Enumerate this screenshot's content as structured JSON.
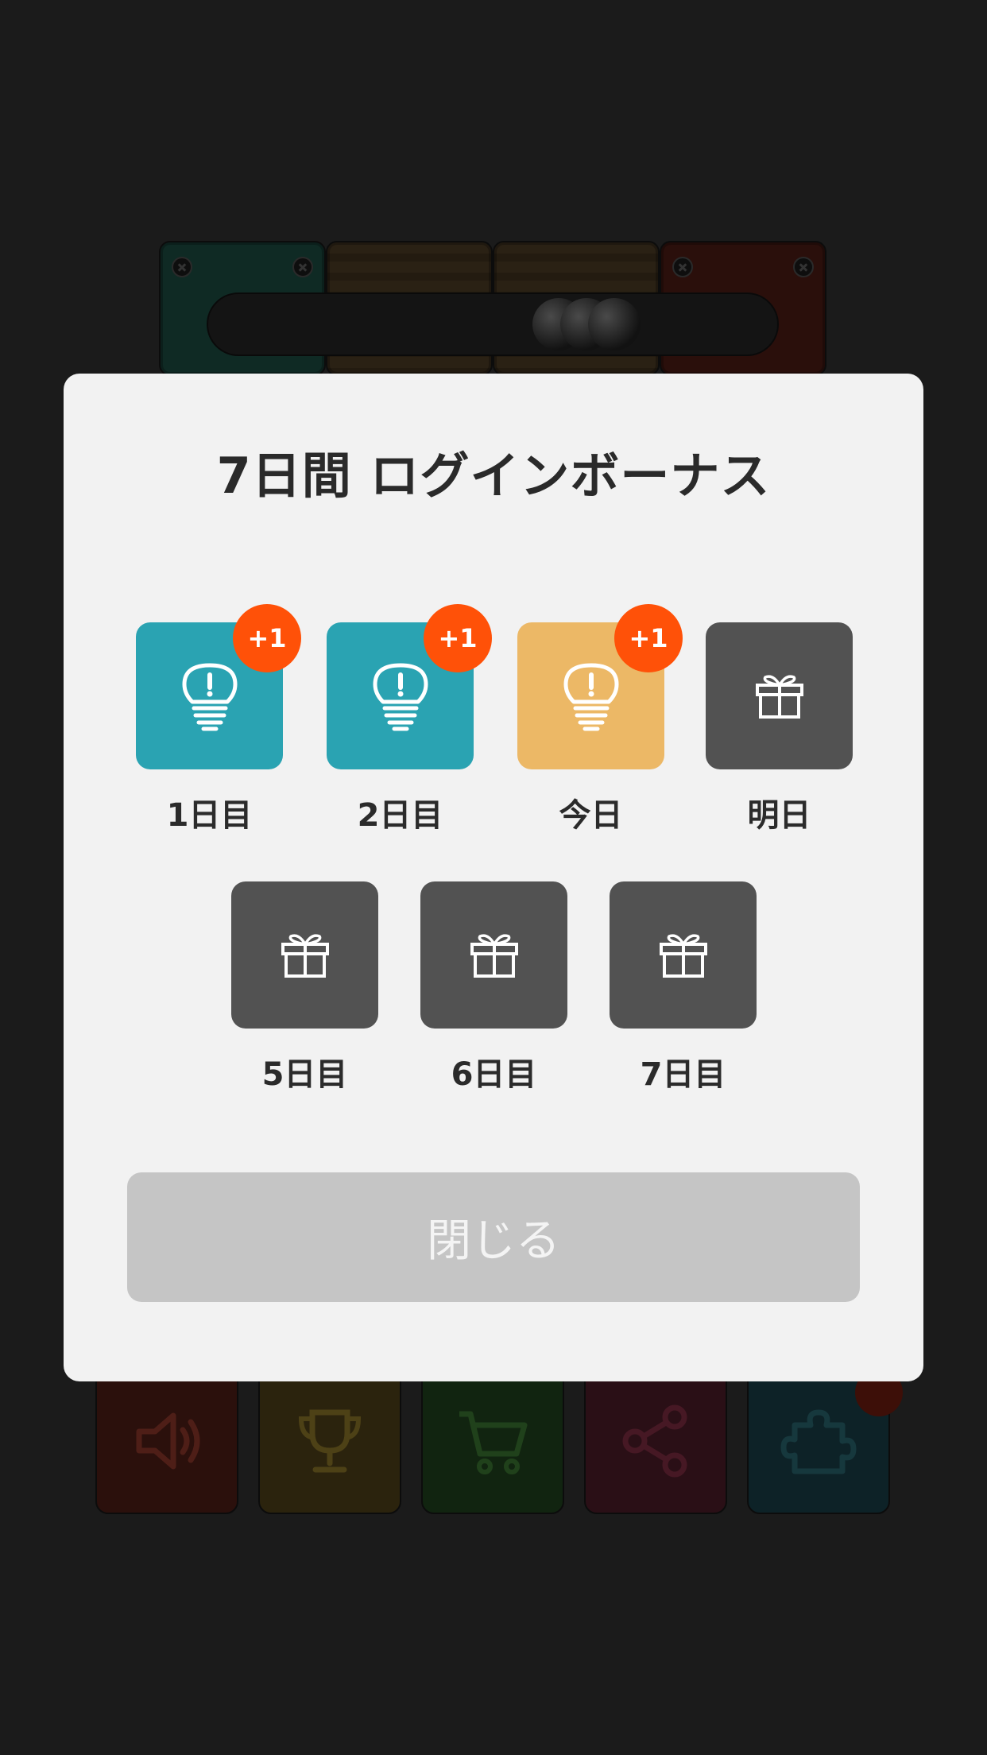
{
  "colors": {
    "claimed": "#2aa3b2",
    "today": "#ecb866",
    "locked": "#525252",
    "badge": "#ff5108",
    "button_bg": "#c5c5c5"
  },
  "modal": {
    "title": "7日間 ログインボーナス",
    "days": [
      {
        "label": "1日目",
        "icon": "lightbulb-icon",
        "state": "claimed",
        "badge": "+1"
      },
      {
        "label": "2日目",
        "icon": "lightbulb-icon",
        "state": "claimed",
        "badge": "+1"
      },
      {
        "label": "今日",
        "icon": "lightbulb-icon",
        "state": "today",
        "badge": "+1"
      },
      {
        "label": "明日",
        "icon": "gift-icon",
        "state": "locked"
      },
      {
        "label": "5日目",
        "icon": "gift-icon",
        "state": "locked"
      },
      {
        "label": "6日目",
        "icon": "gift-icon",
        "state": "locked"
      },
      {
        "label": "7日目",
        "icon": "gift-icon",
        "state": "locked"
      }
    ],
    "close_label": "閉じる"
  },
  "background": {
    "bottom_buttons": [
      {
        "icon": "speaker-icon"
      },
      {
        "icon": "trophy-icon"
      },
      {
        "icon": "cart-icon"
      },
      {
        "icon": "share-icon"
      },
      {
        "icon": "puzzle-icon"
      }
    ]
  }
}
